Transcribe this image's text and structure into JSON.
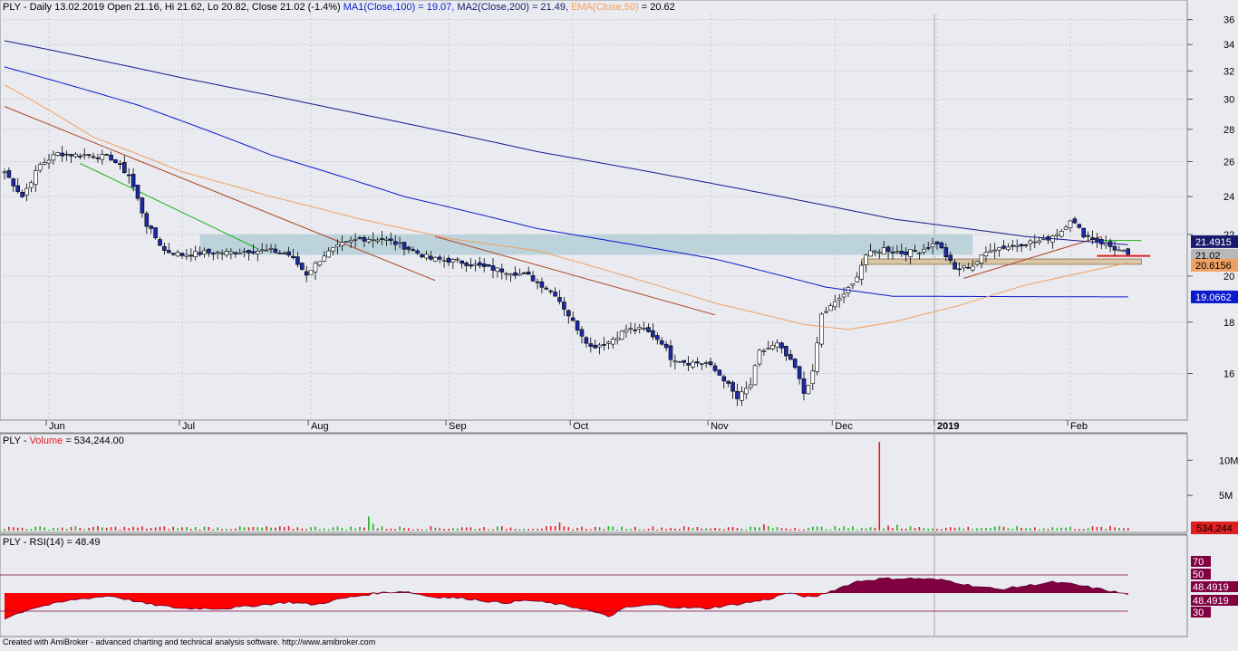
{
  "price_panel": {
    "symbol": "PLY",
    "period": "Daily",
    "date": "13.02.2019",
    "open": "Open 21.16,",
    "high": "Hi 21.62,",
    "low": "Lo 20.82,",
    "close": "Close 21.02 (-1.4%)",
    "ma1": "MA1(Close,100) = 19.07,",
    "ma2": "MA2(Close,200) = 21.49,",
    "ema": "EMA(Close,50)",
    "ema_value": "= 20.62",
    "colors": {
      "ma1": "#0a1acc",
      "ma2": "#1a1a8c",
      "ema": "#f0a060",
      "up": "#ffffff",
      "down": "#1c2aa8",
      "trend_down": "#b04020",
      "trend_green": "#20b020",
      "zone": "#b4cfd8"
    }
  },
  "volume_panel": {
    "label": "PLY - ",
    "name": "Volume",
    "value": "= 534,244.00",
    "last": "534,244",
    "colors": {
      "up": "#20b020",
      "down": "#e02020"
    }
  },
  "rsi_panel": {
    "label": "PLY - RSI(14) = 48.49",
    "last": "48.4919",
    "colors": {
      "fill_up": "#800040",
      "fill_down": "#ff0000"
    }
  },
  "price_scale_badges": {
    "ma2": "21.4915",
    "close": "21.02",
    "ema": "20.6156",
    "ma1": "19.0662"
  },
  "footer": "Created with AmiBroker - advanced charting and technical analysis software. http://www.amibroker.com",
  "chart_data": [
    {
      "type": "candlestick",
      "title": "PLY - Daily",
      "x_labels": [
        "Jun",
        "Jul",
        "Aug",
        "Sep",
        "Oct",
        "Nov",
        "Dec",
        "2019",
        "Feb"
      ],
      "y_ticks": [
        16,
        18,
        20,
        22,
        24,
        26,
        28,
        30,
        32,
        34,
        36
      ],
      "ylim": [
        14.5,
        36.5
      ],
      "y_scale": "log",
      "grid": true,
      "close_anchors": [
        [
          0,
          25.4
        ],
        [
          4,
          24.0
        ],
        [
          8,
          25.8
        ],
        [
          12,
          26.5
        ],
        [
          16,
          26.4
        ],
        [
          20,
          26.4
        ],
        [
          24,
          26.2
        ],
        [
          28,
          25.2
        ],
        [
          32,
          22.5
        ],
        [
          36,
          21.2
        ],
        [
          40,
          21.0
        ],
        [
          45,
          21.1
        ],
        [
          50,
          21.1
        ],
        [
          55,
          21.2
        ],
        [
          60,
          21.2
        ],
        [
          64,
          21.0
        ],
        [
          68,
          20.1
        ],
        [
          72,
          21.0
        ],
        [
          76,
          21.5
        ],
        [
          80,
          21.8
        ],
        [
          85,
          21.8
        ],
        [
          90,
          21.4
        ],
        [
          96,
          20.8
        ],
        [
          102,
          20.7
        ],
        [
          108,
          20.4
        ],
        [
          114,
          20.2
        ],
        [
          118,
          20.0
        ],
        [
          124,
          19.2
        ],
        [
          128,
          18.0
        ],
        [
          132,
          17.0
        ],
        [
          136,
          17.2
        ],
        [
          140,
          17.7
        ],
        [
          144,
          17.7
        ],
        [
          148,
          17.2
        ],
        [
          150,
          16.6
        ],
        [
          154,
          16.4
        ],
        [
          158,
          16.4
        ],
        [
          162,
          15.8
        ],
        [
          165,
          15.1
        ],
        [
          168,
          15.6
        ],
        [
          170,
          16.8
        ],
        [
          174,
          17.1
        ],
        [
          178,
          16.2
        ],
        [
          180,
          15.3
        ],
        [
          182,
          16.0
        ],
        [
          184,
          18.3
        ],
        [
          187,
          18.8
        ],
        [
          191,
          19.6
        ],
        [
          194,
          21.0
        ],
        [
          198,
          21.3
        ],
        [
          202,
          21.1
        ],
        [
          206,
          21.2
        ],
        [
          210,
          21.6
        ],
        [
          214,
          20.3
        ],
        [
          218,
          20.5
        ],
        [
          222,
          21.3
        ],
        [
          226,
          21.4
        ],
        [
          230,
          21.6
        ],
        [
          234,
          21.7
        ],
        [
          238,
          22.2
        ],
        [
          240,
          22.8
        ],
        [
          243,
          22.0
        ],
        [
          246,
          21.7
        ],
        [
          248,
          21.5
        ],
        [
          250,
          21.3
        ],
        [
          253,
          21.02
        ]
      ],
      "overlays": [
        "MA1(Close,100)",
        "MA2(Close,200)",
        "EMA(Close,50)"
      ],
      "horizontal_levels": [
        20.6156,
        21.7
      ]
    },
    {
      "type": "bar",
      "title": "PLY - Volume",
      "y_ticks_labels": [
        "5M",
        "10M"
      ],
      "ylim": [
        0,
        13000000
      ],
      "note_peaks": [
        [
          82,
          2000000
        ],
        [
          125,
          1150000
        ],
        [
          197,
          12600000
        ]
      ]
    },
    {
      "type": "area",
      "title": "PLY - RSI(14)",
      "ylim": [
        0,
        100
      ],
      "levels": [
        30,
        50,
        70
      ],
      "y_tick_labels": [
        "70",
        "50",
        "30"
      ],
      "anchors": [
        [
          0,
          22
        ],
        [
          6,
          33
        ],
        [
          16,
          43
        ],
        [
          24,
          47
        ],
        [
          32,
          38
        ],
        [
          40,
          33
        ],
        [
          50,
          33
        ],
        [
          56,
          36
        ],
        [
          64,
          40
        ],
        [
          70,
          37
        ],
        [
          76,
          44
        ],
        [
          84,
          50
        ],
        [
          90,
          52
        ],
        [
          96,
          46
        ],
        [
          104,
          44
        ],
        [
          112,
          39
        ],
        [
          118,
          42
        ],
        [
          124,
          38
        ],
        [
          130,
          33
        ],
        [
          136,
          24
        ],
        [
          140,
          34
        ],
        [
          146,
          37
        ],
        [
          152,
          34
        ],
        [
          158,
          33
        ],
        [
          164,
          37
        ],
        [
          168,
          40
        ],
        [
          172,
          43
        ],
        [
          176,
          50
        ],
        [
          182,
          45
        ],
        [
          186,
          52
        ],
        [
          192,
          63
        ],
        [
          198,
          66
        ],
        [
          206,
          66
        ],
        [
          212,
          64
        ],
        [
          218,
          58
        ],
        [
          224,
          54
        ],
        [
          230,
          58
        ],
        [
          236,
          62
        ],
        [
          240,
          60
        ],
        [
          246,
          55
        ],
        [
          253,
          48.49
        ]
      ]
    }
  ]
}
